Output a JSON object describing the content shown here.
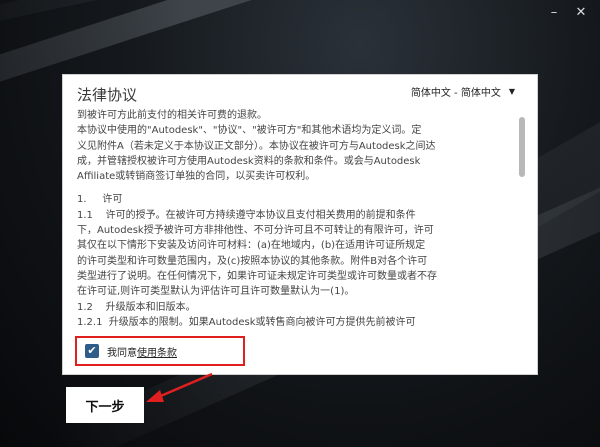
{
  "window": {
    "minimize_glyph": "–",
    "close_glyph": "✕"
  },
  "dialog": {
    "title": "法律协议",
    "language_select": "简体中文 - 简体中文",
    "license_lines": [
      "到被许可方此前支付的相关许可费的退款。",
      "本协议中使用的\"Autodesk\"、\"协议\"、\"被许可方\"和其他术语均为定义词。定",
      "义见附件A（若未定义于本协议正文部分）。本协议在被许可方与Autodesk之间达",
      "成，并管辖授权被许可方使用Autodesk资料的条款和条件。或会与Autodesk",
      "Affiliate或转销商签订单独的合同，以买卖许可权利。",
      "",
      "1.     许可",
      "1.1    许可的授予。在被许可方持续遵守本协议且支付相关费用的前提和条件",
      "下，Autodesk授予被许可方非排他性、不可分许可且不可转让的有限许可，许可",
      "其仅在以下情形下安装及访问许可材料：(a)在地域内，(b)在适用许可证所规定",
      "的许可类型和许可数量范围内，及(c)按照本协议的其他条款。附件B对各个许可",
      "类型进行了说明。在任何情况下，如果许可证未规定许可类型或许可数量或者不存",
      "在许可证,则许可类型默认为评估许可且许可数量默认为一(1)。",
      "1.2    升级版本和旧版本。",
      "1.2.1  升级版本的限制。如果Autodesk或转售商向被许可方提供先前被许可"
    ],
    "agree_prefix": "我同意",
    "agree_link": "使用条款",
    "checkbox_glyph": "✔"
  },
  "footer": {
    "next_label": "下一步"
  },
  "colors": {
    "highlight": "#e02020",
    "checkbox": "#2f5d8a"
  }
}
